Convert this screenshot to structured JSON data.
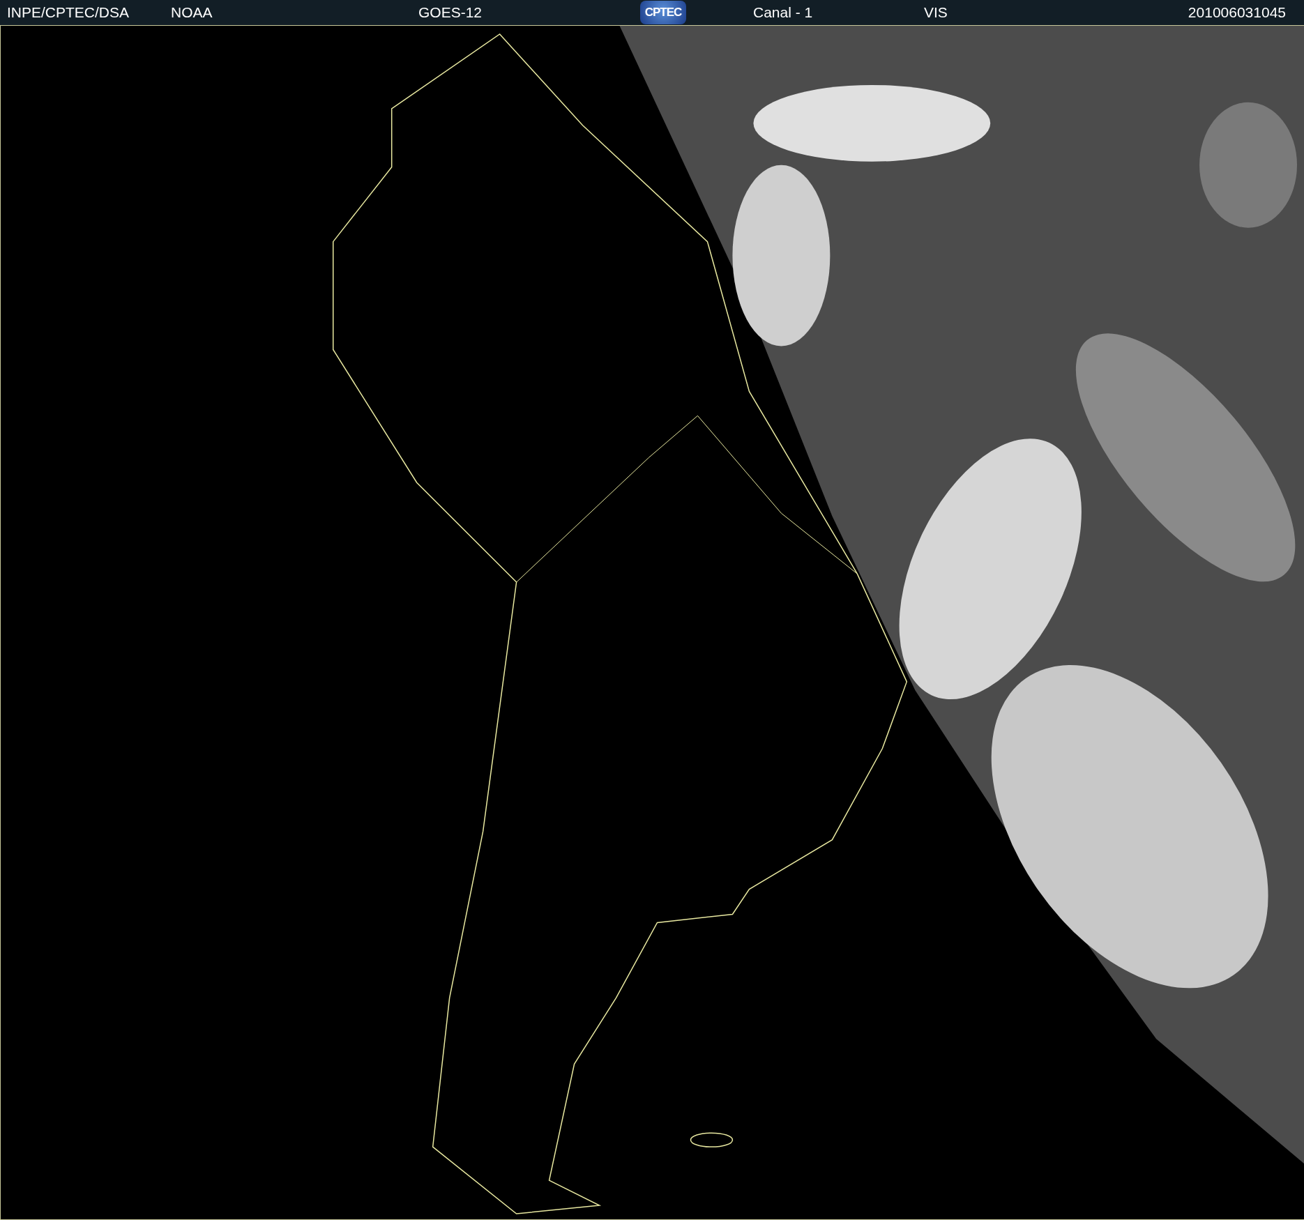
{
  "header": {
    "source": "INPE/CPTEC/DSA",
    "agency": "NOAA",
    "satellite": "GOES-12",
    "logo": "CPTEC",
    "channel": "Canal - 1",
    "band": "VIS",
    "timestamp": "201006031045"
  }
}
